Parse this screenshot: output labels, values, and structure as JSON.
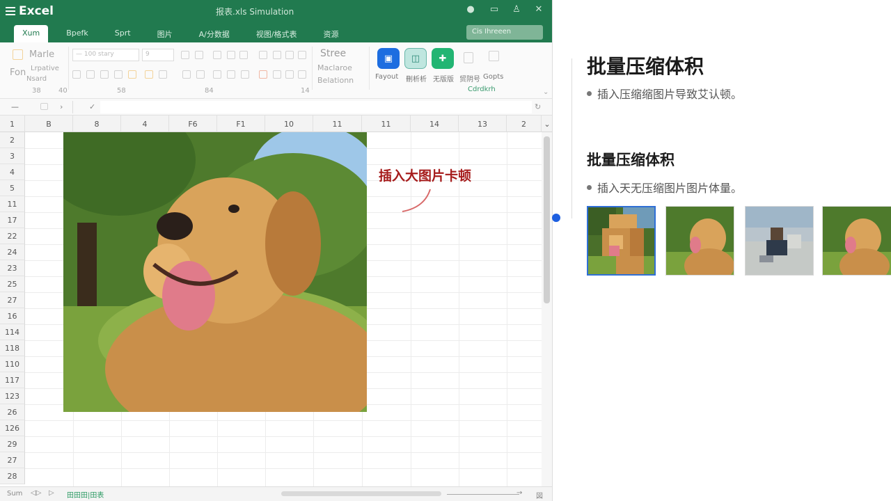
{
  "app": {
    "name": "Excel",
    "doc_title": "报表.xls Simulation",
    "search_placeholder": "Cis Ihreeen"
  },
  "ribbon_tabs": [
    "Xum",
    "Bpefk",
    "Sprt",
    "图片",
    "A/分数据",
    "视图/格式表",
    "资源"
  ],
  "ribbon": {
    "paste_label": "Marle",
    "paste_sub1": "Fon",
    "paste_sub2": "Lrpative",
    "paste_sub3": "Nsard",
    "font_name": "— 100 stary",
    "font_size": "9",
    "styles_label": "Stree",
    "styles_sub1": "Maclaroe",
    "styles_sub2": "Belationn",
    "btn_labels": [
      "Fayout",
      "刪析析",
      "无版版",
      "贸阴号",
      "Gopts"
    ],
    "addin_label": "Cdrdkrh",
    "group_labels": [
      "38",
      "40",
      "58",
      "84",
      "14"
    ]
  },
  "formula_bar": {
    "name_box": "—",
    "check": "✓"
  },
  "sheet": {
    "col_headers": [
      "1",
      "B",
      "8",
      "4",
      "F6",
      "F1",
      "10",
      "11",
      "11",
      "14",
      "13",
      "2"
    ],
    "row_headers": [
      "2",
      "3",
      "4",
      "5",
      "11",
      "17",
      "22",
      "24",
      "23",
      "25",
      "27",
      "16",
      "114",
      "118",
      "110",
      "117",
      "123",
      "26",
      "126",
      "29",
      "27",
      "28"
    ],
    "note_text": "插入大图片卡顿"
  },
  "statusbar": {
    "sheet_name": "Sum",
    "sheet_tab": "田田田|田表",
    "page_indicator": "図"
  },
  "panel": {
    "heading1": "批量压缩体积",
    "bullet1": "插入压缩缩图片导致艾认顿。",
    "heading2": "批量压缩体积",
    "bullet2": "插入天无压缩图片图片体量。"
  },
  "colors": {
    "excel_green": "#217a4f",
    "accent_blue": "#1d5fe0",
    "note_red": "#a61c1c"
  }
}
